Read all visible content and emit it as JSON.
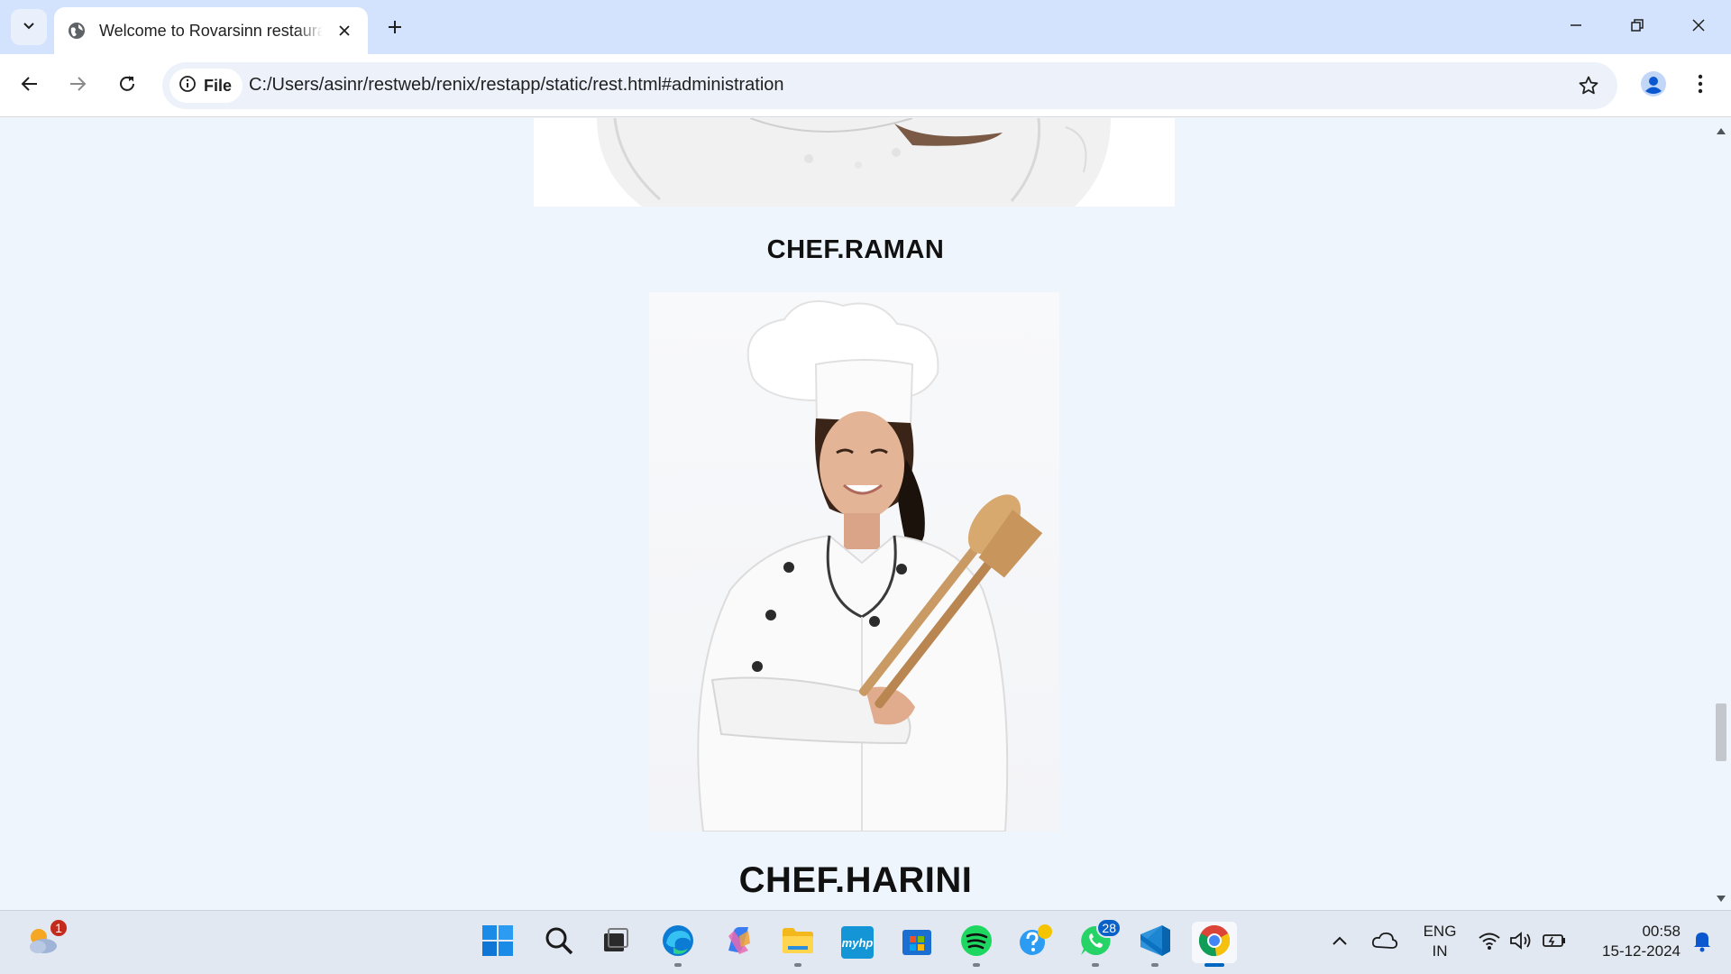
{
  "browser": {
    "tab_title": "Welcome to Rovarsinn restaurant",
    "site_chip_label": "File",
    "url": "C:/Users/asinr/restweb/renix/restapp/static/rest.html#administration"
  },
  "page": {
    "chefs": [
      {
        "name": "CHEF.RAMAN"
      },
      {
        "name": "CHEF.HARINI"
      }
    ]
  },
  "taskbar": {
    "weather_badge": "1",
    "whatsapp_badge": "28",
    "myhp_label": "myhp",
    "language_line1": "ENG",
    "language_line2": "IN",
    "time": "00:58",
    "date": "15-12-2024"
  }
}
